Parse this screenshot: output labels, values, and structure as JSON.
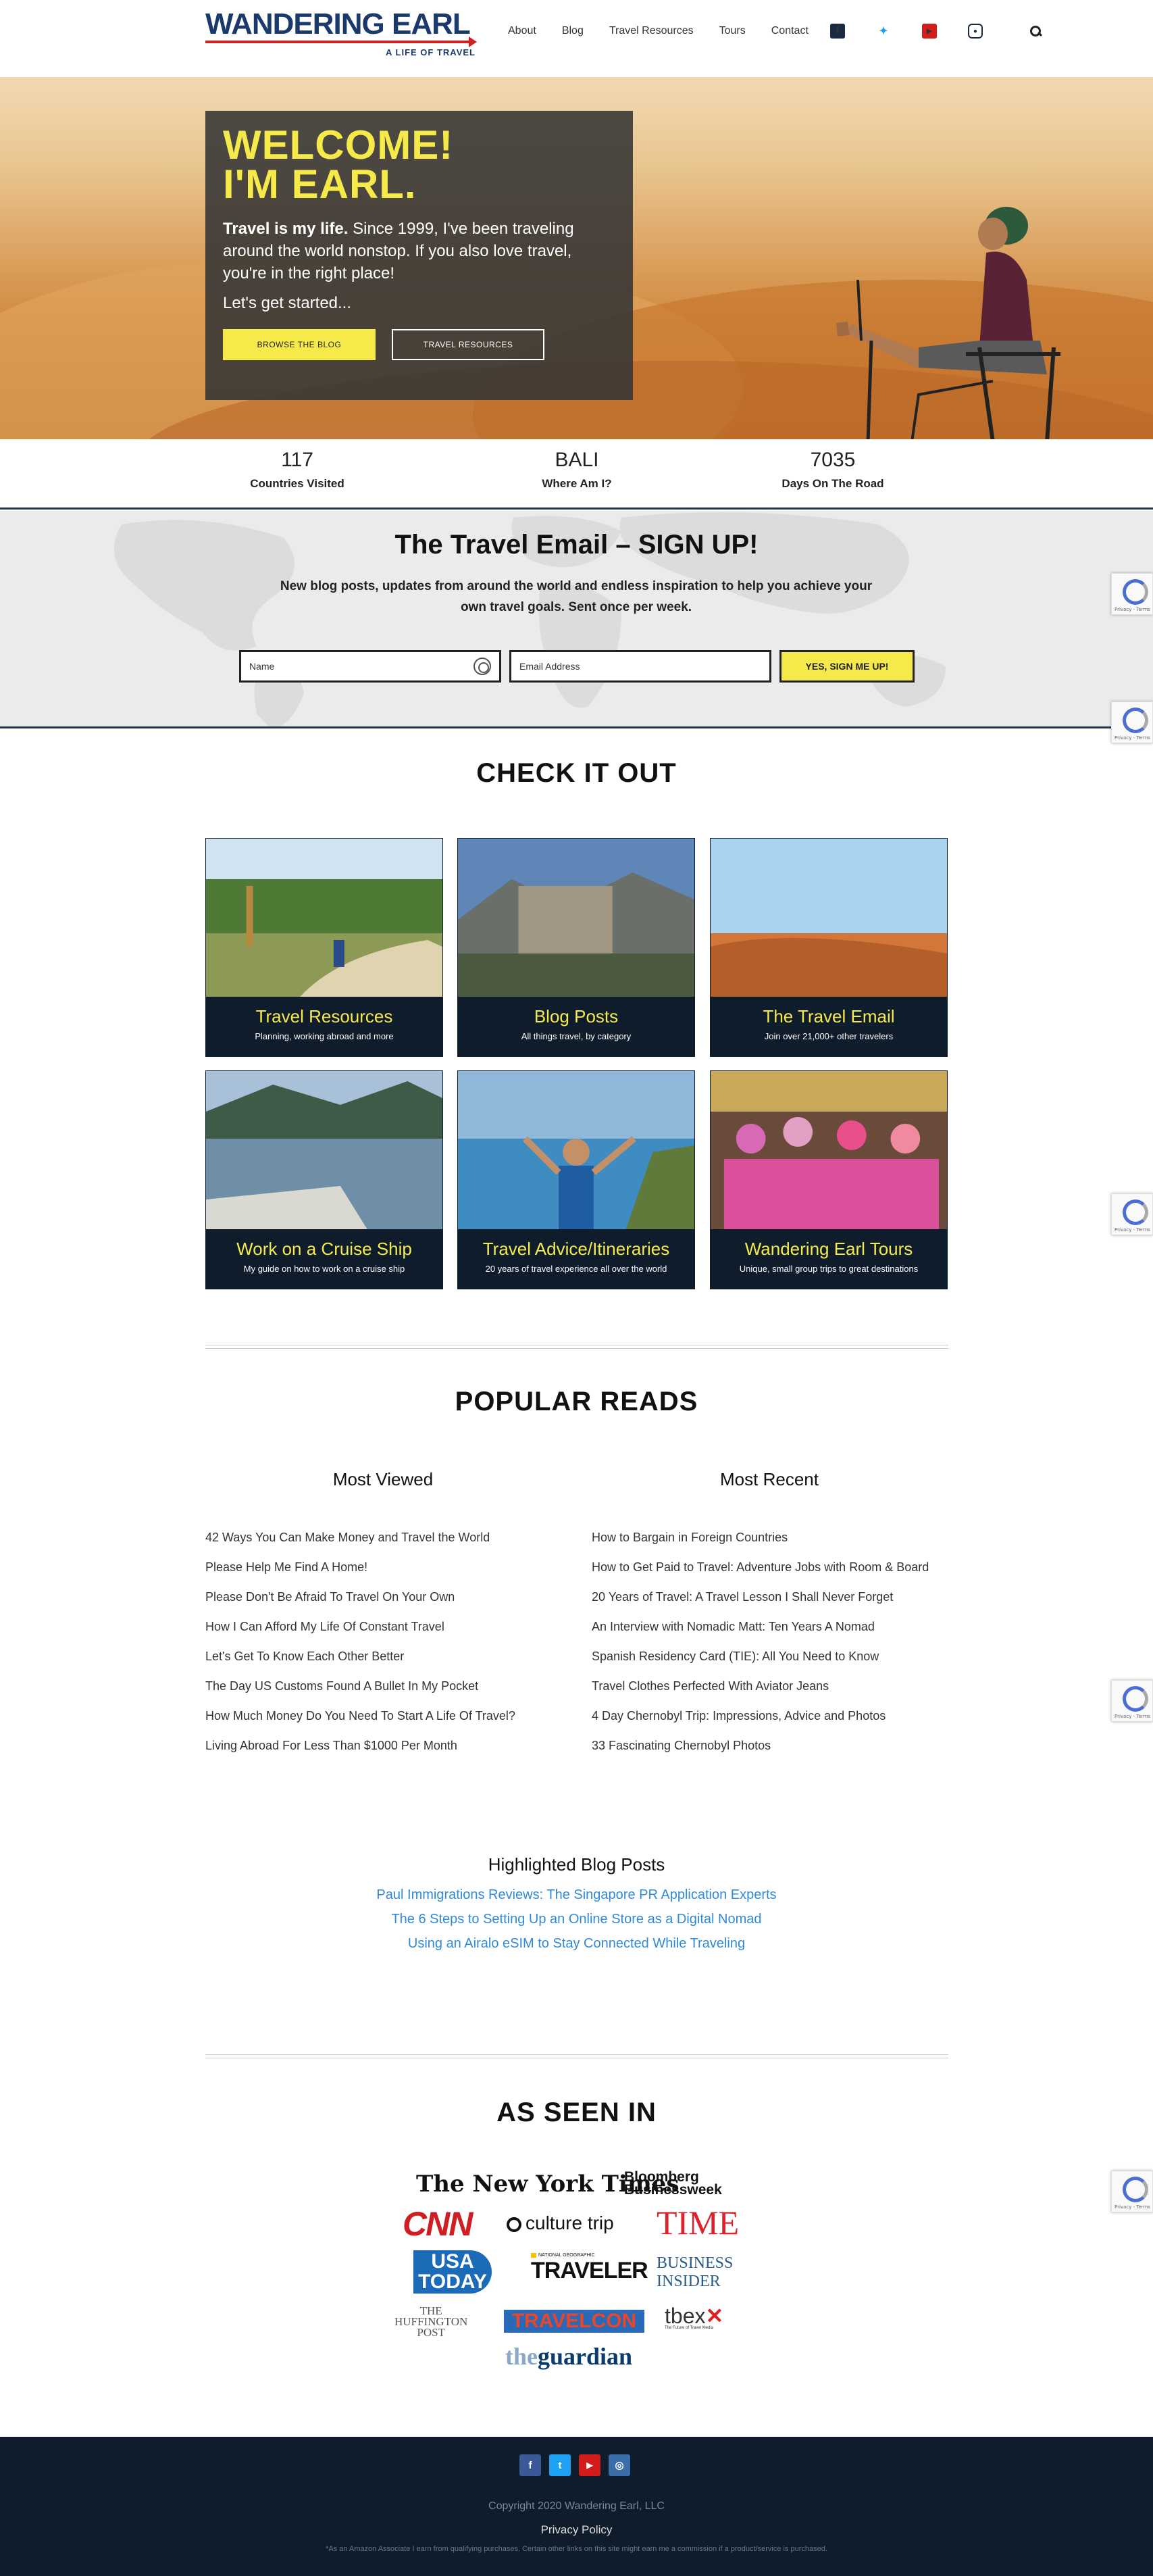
{
  "header": {
    "logo_main": "WANDERING EARL",
    "logo_sub": "A LIFE OF TRAVEL",
    "nav": [
      "About",
      "Blog",
      "Travel Resources",
      "Tours",
      "Contact"
    ],
    "social_icons": [
      "facebook-icon",
      "twitter-icon",
      "youtube-icon",
      "instagram-icon"
    ]
  },
  "hero": {
    "title_line1": "WELCOME!",
    "title_line2": "I'M EARL.",
    "text_bold": "Travel is my life.",
    "text": " Since 1999, I've been traveling around the world nonstop. If you also love travel, you're in the right place!",
    "start": "Let's get started...",
    "btn_blog": "BROWSE THE BLOG",
    "btn_resources": "TRAVEL RESOURCES"
  },
  "stats": [
    {
      "value": "117",
      "label": "Countries Visited"
    },
    {
      "value": "BALI",
      "label": "Where Am I?"
    },
    {
      "value": "7035",
      "label": "Days On The Road"
    }
  ],
  "signup": {
    "title": "The Travel  Email – SIGN UP!",
    "text": "New blog posts, updates from around the world and endless inspiration to help you achieve your own travel goals. Sent once per week.",
    "name_placeholder": "Name",
    "email_placeholder": "Email Address",
    "button": "YES, SIGN ME UP!"
  },
  "check": {
    "title": "CHECK IT OUT",
    "cards": [
      {
        "title": "Travel Resources",
        "sub": "Planning, working abroad and more"
      },
      {
        "title": "Blog Posts",
        "sub": "All things travel, by category"
      },
      {
        "title": "The Travel Email",
        "sub": "Join over 21,000+ other travelers"
      },
      {
        "title": "Work on a Cruise Ship",
        "sub": "My guide on how to work on a cruise ship"
      },
      {
        "title": "Travel Advice/Itineraries",
        "sub": "20 years of travel experience all over the world"
      },
      {
        "title": "Wandering Earl Tours",
        "sub": "Unique, small group trips to great destinations"
      }
    ]
  },
  "popular": {
    "title": "POPULAR READS",
    "most_viewed_title": "Most Viewed",
    "most_recent_title": "Most Recent",
    "most_viewed": [
      "42 Ways You Can Make Money and Travel the World",
      "Please Help Me Find A Home!",
      "Please Don't Be Afraid To Travel On Your Own",
      "How I Can Afford My Life Of Constant Travel",
      "Let's Get To Know Each Other Better",
      "The Day US Customs Found A Bullet In My Pocket",
      "How Much Money Do You Need To Start A Life Of Travel?",
      "Living Abroad For Less Than $1000 Per Month"
    ],
    "most_recent": [
      "How to Bargain in Foreign Countries",
      "How to Get Paid to Travel: Adventure Jobs with Room & Board",
      "20 Years of Travel: A Travel Lesson I Shall Never Forget",
      "An Interview with Nomadic Matt: Ten Years A Nomad",
      "Spanish Residency Card (TIE): All You Need to Know",
      "Travel Clothes Perfected With Aviator Jeans",
      "4 Day Chernobyl Trip: Impressions, Advice and Photos",
      "33 Fascinating Chernobyl Photos"
    ]
  },
  "highlighted": {
    "title": "Highlighted Blog Posts",
    "links": [
      "Paul Immigrations Reviews: The Singapore PR Application Experts",
      "The 6 Steps to Setting Up an Online Store as a Digital Nomad",
      "Using an Airalo eSIM to Stay Connected While Traveling"
    ]
  },
  "seen": {
    "title": "AS SEEN IN",
    "logos": {
      "nyt": "The New York Times",
      "bloomberg1": "Bloomberg",
      "bloomberg2": "Businessweek",
      "cnn": "CNN",
      "culture": "culture trip",
      "time": "TIME",
      "usa1": "USA",
      "usa2": "TODAY",
      "ng_small": "NATIONAL GEOGRAPHIC",
      "traveler": "TRAVELER",
      "bi1": "BUSINESS",
      "bi2": "INSIDER",
      "huff1": "THE",
      "huff2": "HUFFINGTON",
      "huff3": "POST",
      "travelcon": "TRAVELCON",
      "tbex": "tbex",
      "tbex_sub": "The Future of Travel Media",
      "guardian1": "the",
      "guardian2": "guardian"
    }
  },
  "footer": {
    "social": [
      "f",
      "t",
      "▶",
      "◎"
    ],
    "copyright": "Copyright 2020 Wandering Earl, LLC",
    "privacy": "Privacy Policy",
    "note": "*As an Amazon Associate I earn from qualifying purchases. Certain other links on this site might earn me a commission if a product/service is purchased."
  },
  "recaptcha": "Privacy - Terms",
  "colors": {
    "navy": "#0f1c2b",
    "accent_yellow": "#f5ea4a",
    "link_blue": "#2f8ad8",
    "logo_blue": "#1a3a6c"
  }
}
